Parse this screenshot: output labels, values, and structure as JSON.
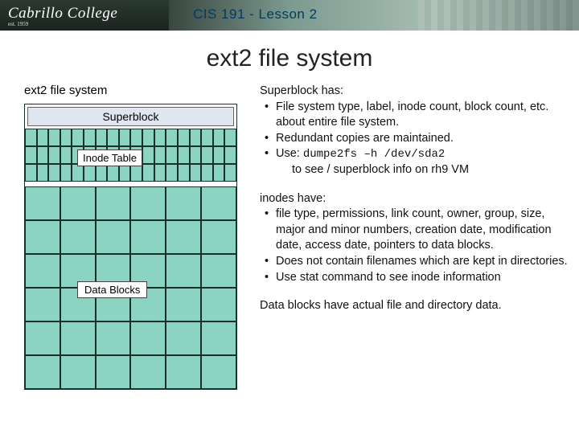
{
  "header": {
    "logo_main": "Cabrillo College",
    "logo_sub": "est. 1959",
    "course": "CIS 191 - Lesson 2"
  },
  "title": "ext2 file system",
  "diagram": {
    "caption": "ext2 file system",
    "superblock_label": "Superblock",
    "inode_label": "Inode Table",
    "data_label": "Data Blocks"
  },
  "superblock": {
    "heading": "Superblock has:",
    "b1": "File system type, label, inode count, block count, etc. about entire file system.",
    "b2": "Redundant copies are maintained.",
    "b3_prefix": "Use: ",
    "b3_cmd": "dumpe2fs –h /dev/sda2",
    "b3_tail": " to see / superblock info on rh9 VM"
  },
  "inodes": {
    "heading": "inodes have:",
    "b1": "file type, permissions, link count, owner, group, size, major and minor numbers, creation date, modification date, access date, pointers to data blocks.",
    "b2": "Does not contain filenames which are kept in directories.",
    "b3": "Use stat command to see inode information"
  },
  "datablocks": {
    "text": "Data blocks have actual file and directory data."
  }
}
